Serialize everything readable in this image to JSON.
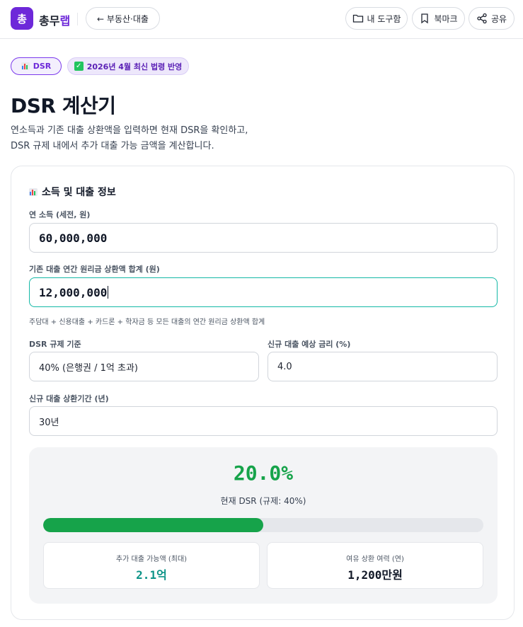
{
  "header": {
    "logo_char": "총",
    "brand_main": "총무",
    "brand_accent": "랩",
    "back_label": "← 부동산·대출",
    "tools_label": "내 도구함",
    "bookmark_label": "북마크",
    "share_label": "공유"
  },
  "badges": {
    "category": "DSR",
    "update": "2026년 4월 최신 법령 반영"
  },
  "page": {
    "title": "DSR 계산기",
    "desc_line1": "연소득과 기존 대출 상환액을 입력하면 현재 DSR을 확인하고,",
    "desc_line2": "DSR 규제 내에서 추가 대출 가능 금액을 계산합니다."
  },
  "form": {
    "section_title": "소득 및 대출 정보",
    "income_label": "연 소득 (세전, 원)",
    "income_value": "60,000,000",
    "repay_label": "기존 대출 연간 원리금 상환액 합계 (원)",
    "repay_value": "12,000,000",
    "repay_help": "주담대 + 신용대출 + 카드론 + 학자금 등 모든 대출의 연간 원리금 상환액 합계",
    "reg_label": "DSR 규제 기준",
    "reg_value": "40% (은행권 / 1억 초과)",
    "rate_label": "신규 대출 예상 금리 (%)",
    "rate_value": "4.0",
    "term_label": "신규 대출 상환기간 (년)",
    "term_value": "30년"
  },
  "result": {
    "dsr_value": "20.0%",
    "dsr_caption": "현재 DSR (규제: 40%)",
    "progress_fraction": 0.5,
    "add_loan_label": "추가 대출 가능액 (최대)",
    "add_loan_num": "2.1",
    "add_loan_unit": "억",
    "capacity_label": "여유 상환 여력 (연)",
    "capacity_num": "1,200",
    "capacity_unit": "만원"
  },
  "colors": {
    "brand": "#6d28d9",
    "success": "#16a34a",
    "teal": "#0d9488",
    "focus_border": "#14b8a6"
  },
  "icons": {
    "tools": "folder-icon",
    "bookmark": "bookmark-icon",
    "share": "share-icon",
    "category": "bar-chart-icon",
    "update": "check-box-icon"
  }
}
